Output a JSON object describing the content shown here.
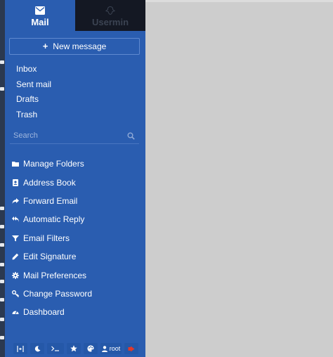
{
  "tabs": [
    {
      "label": "Mail",
      "icon": "envelope-icon",
      "active": true
    },
    {
      "label": "Usermin",
      "icon": "usermin-logo-icon",
      "active": false
    }
  ],
  "new_message": {
    "label": "New message",
    "icon": "plus-icon"
  },
  "folders": [
    {
      "label": "Inbox"
    },
    {
      "label": "Sent mail"
    },
    {
      "label": "Drafts"
    },
    {
      "label": "Trash"
    }
  ],
  "search": {
    "placeholder": "Search",
    "icon": "search-icon"
  },
  "menu": [
    {
      "label": "Manage Folders",
      "icon": "folder-icon"
    },
    {
      "label": "Address Book",
      "icon": "address-book-icon"
    },
    {
      "label": "Forward Email",
      "icon": "forward-icon"
    },
    {
      "label": "Automatic Reply",
      "icon": "reply-all-icon"
    },
    {
      "label": "Email Filters",
      "icon": "filter-icon"
    },
    {
      "label": "Edit Signature",
      "icon": "pencil-icon"
    },
    {
      "label": "Mail Preferences",
      "icon": "gear-icon"
    },
    {
      "label": "Change Password",
      "icon": "key-icon"
    },
    {
      "label": "Dashboard",
      "icon": "dashboard-icon"
    }
  ],
  "bottom_bar": {
    "user_label": "root",
    "icons": [
      "collapse-icon",
      "moon-icon",
      "terminal-icon",
      "star-icon",
      "palette-icon",
      "user-icon",
      "logout-icon"
    ]
  },
  "colors": {
    "sidebar": "#2a5db0",
    "usermin_tab": "#141823",
    "content": "#cdcdcd",
    "logout": "#e0392b"
  }
}
